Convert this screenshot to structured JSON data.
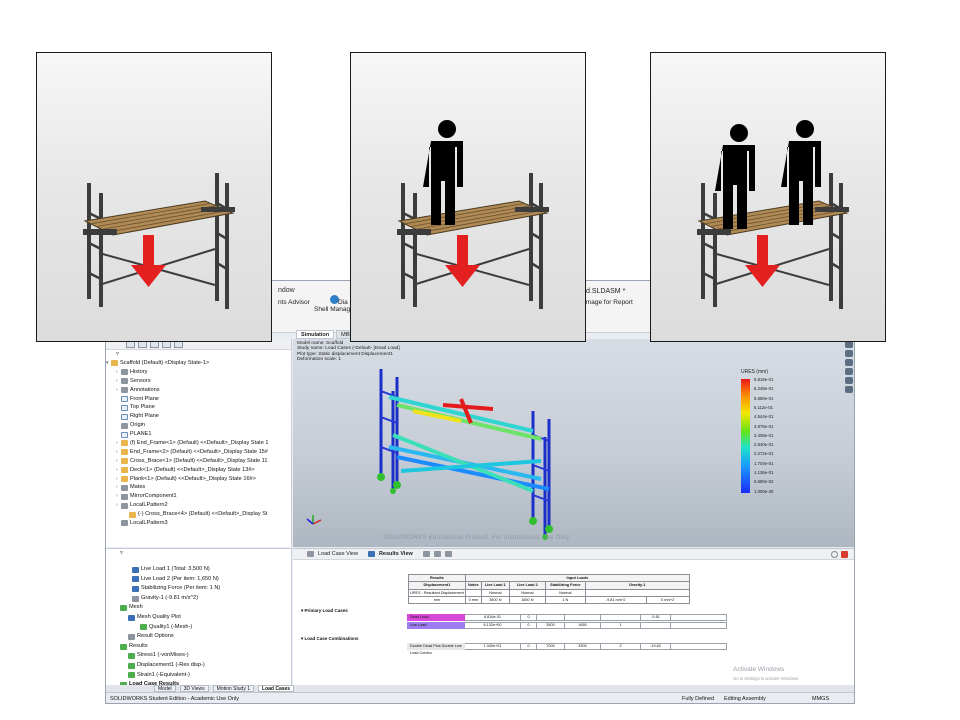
{
  "window": {
    "title_left": "ndow",
    "title_right": "d.SLDASM *"
  },
  "ribbon": {
    "items": [
      "nts Advisor",
      "Shell Manager",
      "Dia",
      "Image for Report"
    ]
  },
  "command_tabs": [
    "Simulation",
    "MBD"
  ],
  "feature_tree": {
    "root": "Scaffold (Default) <Display State-1>",
    "items": [
      "History",
      "Sensors",
      "Annotations",
      "Front Plane",
      "Top Plane",
      "Right Plane",
      "Origin",
      "PLANE1",
      "(f) End_Frame<1> (Default) <<Default>_Display State 1",
      "End_Frame<2> (Default) <<Default>_Display State 15#",
      "Cross_Brace<1> (Default) <<Default>_Display State 11",
      "Deck<1> (Default) <<Default>_Display State 13#>",
      "Plank<1> (Default) <<Default>_Display State 16#>",
      "Mates",
      "MirrorComponent1",
      "LocalLPattern2",
      "(-) Cross_Brace<4> (Default) <<Default>_Display St",
      "LocalLPattern3"
    ]
  },
  "sim_tree": {
    "items": [
      "Live Load 1 (Total: 3,500 N)",
      "Live Load 2 (Per item: 1,650 N)",
      "Stabilizing Force (Per item: 1 N)",
      "Gravity-1 (-9.81 m/s^2)",
      "Mesh",
      "Mesh Quality Plot",
      "Quality1 (-Mesh-)",
      "Result Options",
      "Results",
      "Stress1 (-vonMises-)",
      "Displacement1 (-Res disp-)",
      "Strain1 (-Equivalent-)",
      "Load Case Results",
      "Displacement1 (-Res disp-)"
    ]
  },
  "viewport": {
    "info": [
      "Model name: Scaffold",
      "Study name: Load Cases (-Default- [Dead Load]",
      "Plot type: Static displacement Displacement1",
      "Deformation scale: 1"
    ],
    "watermark": "SOLIDWORKS Educational Product. For Instructional Use Only.",
    "legend_title": "URES (mm)",
    "legend_values": [
      "6.816e-01",
      "6.248e-01",
      "5.680e-01",
      "5.112e-01",
      "4.544e-01",
      "3.976e-01",
      "3.408e-01",
      "2.840e-01",
      "2.272e-01",
      "1.704e-01",
      "1.136e-01",
      "5.680e-02",
      "1.000e-30"
    ]
  },
  "results_panel": {
    "tabs": [
      "Load Case View",
      "Results View"
    ],
    "header": {
      "results": "Results",
      "input_loads": "Input Loads",
      "displacement": "Displacement1",
      "notes": "Notes",
      "live_load_1": "Live Load 1",
      "live_load_2": "Live Load 2",
      "stabilizing": "Stabilizing Force",
      "gravity": "Gravity-1",
      "ures": "URES : Resultant Displacement",
      "units_mm": "mm",
      "v_0mm": "0 mm",
      "v_3500": "3500 N",
      "v_1650": "1650 N",
      "v_1n": "1 N",
      "v_g": "-9.81 m/s^2",
      "v_g2": "0 m/s^2",
      "v_g3": "0 m/s^2",
      "normal1": "Normal",
      "normal2": "Normal",
      "normal3": "Normal"
    },
    "primary_label": "Primary Load Cases",
    "primary_rows": [
      {
        "name": "Dead Load",
        "disp": "6.816e-01",
        "notes": "0",
        "ll1": "",
        "ll2": "",
        "stab": "",
        "grav": "-9.81"
      },
      {
        "name": "Live Load",
        "disp": "6.132e+00",
        "notes": "0",
        "ll1": "3500",
        "ll2": "1650",
        "stab": "1",
        "grav": ""
      }
    ],
    "combo_label": "Load Case Combinations",
    "combo_rows": [
      {
        "name": "Double Dead Plus Double Live Load Combo",
        "disp": "1.340e+01",
        "notes": "0",
        "ll1": "7000",
        "ll2": "3300",
        "stab": "2",
        "grav": "-19.62"
      }
    ],
    "activate_title": "Activate Windows",
    "activate_sub": "Go to Settings to activate Windows."
  },
  "bottom_tabs": [
    "Model",
    "3D Views",
    "Motion Study 1",
    "Load Cases"
  ],
  "status": {
    "left": "SOLIDWORKS Student Edition - Academic Use Only",
    "fully_defined": "Fully Defined",
    "editing": "Editing Assembly",
    "units": "MMGS"
  },
  "panels": [
    {
      "figures": 0
    },
    {
      "figures": 1
    },
    {
      "figures": 2
    }
  ],
  "colors": {
    "arrow": "#e41f1f",
    "frame": "#3c3c3c",
    "plank": "#b08a55"
  }
}
